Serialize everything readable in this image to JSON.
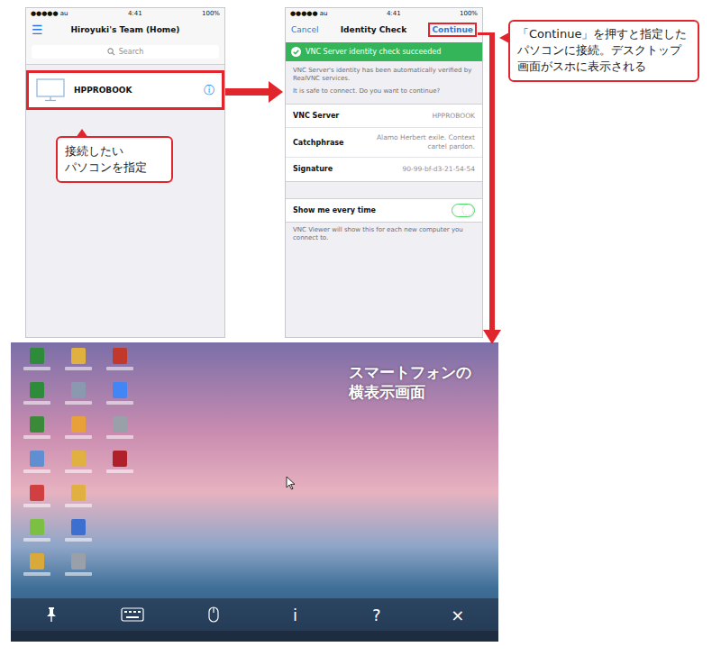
{
  "left_screen": {
    "status": {
      "carrier": "●●●●● au",
      "time": "4:41",
      "battery": "100%"
    },
    "menu_icon": "☰",
    "title": "Hiroyuki's Team (Home)",
    "search": {
      "placeholder": "Search"
    },
    "computers": [
      {
        "name": "HPPROBOOK",
        "info": "ⓘ",
        "selected": true
      }
    ]
  },
  "left_callout": [
    "接続したい",
    "パソコンを指定"
  ],
  "right_screen": {
    "status": {
      "carrier": "●●●●● au",
      "time": "4:41",
      "battery": "100%"
    },
    "nav": {
      "cancel": "Cancel",
      "title": "Identity Check",
      "continue": "Continue"
    },
    "banner": "VNC Server identity check succeeded",
    "intro": [
      "VNC Server's identity has been automatically verified by RealVNC services.",
      "It is safe to connect. Do you want to continue?"
    ],
    "details": [
      {
        "label": "VNC Server",
        "value": "HPPROBOOK"
      },
      {
        "label": "Catchphrase",
        "value": "Alamo Herbert exile. Context cartel pardon."
      },
      {
        "label": "Signature",
        "value": "90-99-bf-d3-21-54-54"
      }
    ],
    "toggle": {
      "label": "Show me every time",
      "on": true,
      "note": "VNC Viewer will show this for each new computer you connect to."
    }
  },
  "right_callout": "「Continue」を押すと指定したパソコンに接続。デスクトップ画面がスホに表示される",
  "desktop": {
    "caption": [
      "スマートフォンの",
      "横表示画面"
    ],
    "icons": [
      {
        "color": "#2e8b3a"
      },
      {
        "color": "#2e8b3a"
      },
      {
        "color": "#3a8a3a"
      },
      {
        "color": "#5f8fd0"
      },
      {
        "color": "#d04040"
      },
      {
        "color": "#7bc043"
      },
      {
        "color": "#d9a93a"
      },
      {
        "color": "#e0b040"
      },
      {
        "color": "#8a98b0"
      },
      {
        "color": "#e8a13a"
      },
      {
        "color": "#e0b040"
      },
      {
        "color": "#e0b040"
      },
      {
        "color": "#3d6fd0"
      },
      {
        "color": "#9aa0aa"
      },
      {
        "color": "#c0392b"
      },
      {
        "color": "#4285f4"
      },
      {
        "color": "#9aa0aa"
      },
      {
        "color": "#b0202a"
      }
    ],
    "toolbar": [
      {
        "kind": "pin",
        "label": ""
      },
      {
        "kind": "keyboard",
        "label": ""
      },
      {
        "kind": "mouse",
        "label": ""
      },
      {
        "kind": "text",
        "label": "i"
      },
      {
        "kind": "text",
        "label": "?"
      },
      {
        "kind": "text",
        "label": "×"
      }
    ]
  }
}
